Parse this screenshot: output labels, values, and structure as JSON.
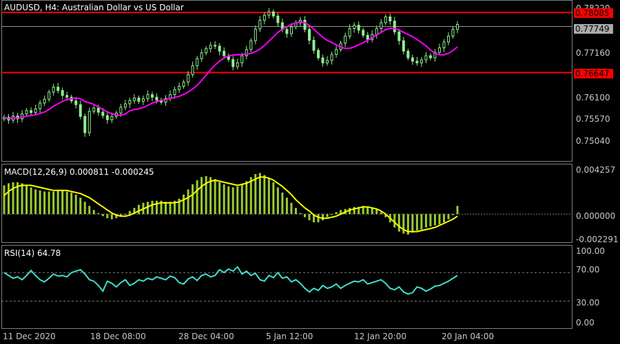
{
  "chart_data": [
    {
      "type": "candlestick",
      "title": "AUDUSD, H4:  Australian Dollar vs US Dollar",
      "symbol": "AUDUSD",
      "timeframe": "H4",
      "ylim": [
        0.7455,
        0.7835
      ],
      "y_ticks": [
        "0.78220",
        "0.77160",
        "0.76100",
        "0.75570",
        "0.75040"
      ],
      "horizontal_levels": [
        {
          "value": 0.78085,
          "label": "0.78085",
          "color": "#ff0000"
        },
        {
          "value": 0.76647,
          "label": "0.76647",
          "color": "#ff0000"
        }
      ],
      "current_price": {
        "value": 0.77749,
        "label": "0.77749"
      },
      "moving_average_color": "#ff00ff",
      "candle_color": "#90ee90",
      "close_series": [
        0.7558,
        0.7551,
        0.7561,
        0.7554,
        0.7566,
        0.7574,
        0.7569,
        0.7578,
        0.7592,
        0.7601,
        0.7618,
        0.763,
        0.7622,
        0.761,
        0.7606,
        0.7597,
        0.7588,
        0.756,
        0.7521,
        0.7572,
        0.758,
        0.757,
        0.7562,
        0.7552,
        0.756,
        0.7568,
        0.7582,
        0.759,
        0.7598,
        0.7604,
        0.7596,
        0.7602,
        0.7612,
        0.7606,
        0.7599,
        0.7594,
        0.7603,
        0.7612,
        0.7624,
        0.7632,
        0.7642,
        0.766,
        0.7681,
        0.7698,
        0.7712,
        0.7722,
        0.773,
        0.7728,
        0.7716,
        0.7705,
        0.7696,
        0.7679,
        0.7688,
        0.7705,
        0.772,
        0.7741,
        0.7769,
        0.779,
        0.7802,
        0.781,
        0.78,
        0.7784,
        0.7768,
        0.7758,
        0.7774,
        0.7784,
        0.779,
        0.7768,
        0.7742,
        0.7718,
        0.77,
        0.7688,
        0.7694,
        0.7708,
        0.772,
        0.7735,
        0.7752,
        0.777,
        0.7778,
        0.7766,
        0.7754,
        0.7744,
        0.7756,
        0.777,
        0.7784,
        0.7798,
        0.7788,
        0.7762,
        0.7741,
        0.7716,
        0.77,
        0.7692,
        0.7688,
        0.7695,
        0.7705,
        0.77,
        0.7713,
        0.7724,
        0.7738,
        0.7752,
        0.7768,
        0.778
      ]
    },
    {
      "type": "histogram+line",
      "title": "MACD(12,26,9) 0.000811 -0.000245",
      "ylim": [
        -0.0026,
        0.0045
      ],
      "y_ticks": [
        "0.004257",
        "0.000000",
        "-0.002291"
      ],
      "histogram_color": "#9acd32",
      "signal_color": "#ffff00",
      "histogram": [
        0.0028,
        0.003,
        0.0031,
        0.0031,
        0.003,
        0.0028,
        0.0026,
        0.0024,
        0.0023,
        0.0022,
        0.0022,
        0.0022,
        0.0023,
        0.0023,
        0.0022,
        0.0021,
        0.0019,
        0.0016,
        0.0012,
        0.0008,
        0.0004,
        0.0001,
        -0.0002,
        -0.0004,
        -0.0005,
        -0.0004,
        -0.0002,
        0.0,
        0.0003,
        0.0006,
        0.0009,
        0.0011,
        0.0012,
        0.0013,
        0.0013,
        0.0013,
        0.0012,
        0.0012,
        0.0013,
        0.0015,
        0.0019,
        0.0024,
        0.0029,
        0.0033,
        0.0036,
        0.0037,
        0.0036,
        0.0034,
        0.0031,
        0.0029,
        0.0027,
        0.0026,
        0.0027,
        0.0029,
        0.0032,
        0.0036,
        0.0039,
        0.004,
        0.0038,
        0.0035,
        0.0031,
        0.0026,
        0.0021,
        0.0016,
        0.0011,
        0.0006,
        0.0001,
        -0.0003,
        -0.0006,
        -0.0008,
        -0.0008,
        -0.0006,
        -0.0003,
        0.0,
        0.0002,
        0.0004,
        0.0005,
        0.0006,
        0.0007,
        0.0007,
        0.0008,
        0.0007,
        0.0006,
        0.0005,
        0.0002,
        -0.0003,
        -0.0008,
        -0.0013,
        -0.0017,
        -0.0019,
        -0.002,
        -0.0018,
        -0.0016,
        -0.0015,
        -0.0013,
        -0.0012,
        -0.0011,
        -0.001,
        -0.0008,
        -0.0005,
        -0.0001,
        0.0008
      ],
      "signal": [
        0.0018,
        0.0022,
        0.0025,
        0.0027,
        0.0028,
        0.0028,
        0.0028,
        0.0027,
        0.0026,
        0.0025,
        0.0024,
        0.0023,
        0.0023,
        0.0023,
        0.0023,
        0.0022,
        0.0021,
        0.002,
        0.0018,
        0.0016,
        0.0013,
        0.001,
        0.0007,
        0.0004,
        0.0001,
        -0.0001,
        -0.0002,
        -0.0002,
        -0.0001,
        0.0001,
        0.0003,
        0.0005,
        0.0007,
        0.0009,
        0.001,
        0.0011,
        0.0011,
        0.0011,
        0.0011,
        0.0012,
        0.0014,
        0.0016,
        0.0019,
        0.0023,
        0.0027,
        0.003,
        0.0032,
        0.0033,
        0.0032,
        0.0031,
        0.003,
        0.0029,
        0.0028,
        0.0029,
        0.003,
        0.0032,
        0.0034,
        0.0036,
        0.0036,
        0.0035,
        0.0033,
        0.003,
        0.0027,
        0.0023,
        0.0019,
        0.0014,
        0.001,
        0.0006,
        0.0003,
        -0.0001,
        -0.0003,
        -0.0004,
        -0.0004,
        -0.0003,
        -0.0002,
        0.0,
        0.0002,
        0.0004,
        0.0005,
        0.0006,
        0.0007,
        0.0007,
        0.0006,
        0.0005,
        0.0003,
        0.0,
        -0.0004,
        -0.0008,
        -0.0012,
        -0.0015,
        -0.0017,
        -0.0017,
        -0.0017,
        -0.0016,
        -0.0015,
        -0.0014,
        -0.0013,
        -0.0011,
        -0.0009,
        -0.0007,
        -0.0005,
        -0.0002
      ]
    },
    {
      "type": "line",
      "title": "RSI(14) 64.78",
      "ylim": [
        0,
        100
      ],
      "y_ticks": [
        "100.00",
        "70.00",
        "30.00",
        "0.00"
      ],
      "levels": [
        70,
        30
      ],
      "color": "#40e0d0",
      "values": [
        70,
        66,
        62,
        64,
        60,
        66,
        73,
        66,
        60,
        57,
        62,
        68,
        65,
        66,
        64,
        70,
        72,
        74,
        68,
        60,
        58,
        52,
        44,
        58,
        55,
        50,
        56,
        60,
        52,
        55,
        60,
        58,
        62,
        60,
        64,
        62,
        60,
        65,
        63,
        56,
        54,
        61,
        64,
        59,
        66,
        68,
        64,
        66,
        74,
        70,
        75,
        72,
        78,
        68,
        72,
        66,
        69,
        60,
        58,
        66,
        63,
        70,
        62,
        64,
        57,
        60,
        55,
        48,
        43,
        48,
        45,
        52,
        48,
        50,
        54,
        48,
        52,
        55,
        58,
        57,
        60,
        54,
        56,
        58,
        60,
        55,
        48,
        46,
        50,
        43,
        40,
        42,
        50,
        48,
        44,
        47,
        51,
        52,
        55,
        58,
        62,
        66
      ]
    }
  ],
  "x_ticks": [
    "11 Dec 2020",
    "18 Dec 08:00",
    "28 Dec 04:00",
    "5 Jan 12:00",
    "12 Jan 20:00",
    "20 Jan 04:00"
  ]
}
